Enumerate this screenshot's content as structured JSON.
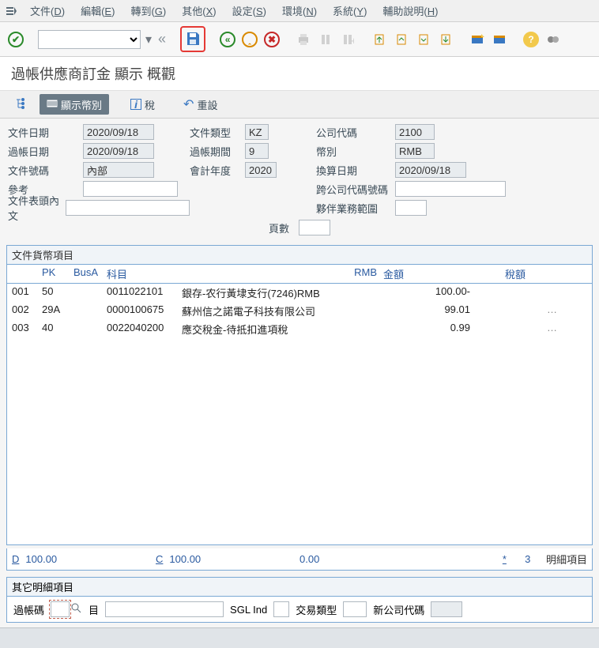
{
  "menu": {
    "items": [
      {
        "label": "文件",
        "key": "D"
      },
      {
        "label": "編輯",
        "key": "E"
      },
      {
        "label": "轉到",
        "key": "G"
      },
      {
        "label": "其他",
        "key": "X"
      },
      {
        "label": "設定",
        "key": "S"
      },
      {
        "label": "環境",
        "key": "N"
      },
      {
        "label": "系統",
        "key": "Y"
      },
      {
        "label": "輔助說明",
        "key": "H"
      }
    ]
  },
  "page_title": "過帳供應商訂金 顯示 概觀",
  "subtoolbar": {
    "show_currency": "顯示幣別",
    "tax": "稅",
    "reset": "重設"
  },
  "form": {
    "doc_date_lbl": "文件日期",
    "doc_date": "2020/09/18",
    "post_date_lbl": "過帳日期",
    "post_date": "2020/09/18",
    "doc_no_lbl": "文件號碼",
    "doc_no": "內部",
    "ref_lbl": "參考",
    "header_text_lbl": "文件表頭內文",
    "doc_type_lbl": "文件類型",
    "doc_type": "KZ",
    "period_lbl": "過帳期間",
    "period": "9",
    "fiscal_year_lbl": "會計年度",
    "fiscal_year": "2020",
    "company_lbl": "公司代碼",
    "company": "2100",
    "currency_lbl": "幣別",
    "currency": "RMB",
    "trans_date_lbl": "換算日期",
    "trans_date": "2020/09/18",
    "cross_cc_lbl": "跨公司代碼號碼",
    "partner_ba_lbl": "夥伴業務範圍",
    "page_lbl": "頁數"
  },
  "grid": {
    "section_title": "文件貨幣項目",
    "head": {
      "pk": "PK",
      "busa": "BusA",
      "acct": "科目",
      "rmb": "RMB",
      "amt": "金額",
      "tax": "稅額"
    },
    "rows": [
      {
        "seq": "001",
        "pk": "50",
        "busa": "",
        "acct": "0011022101",
        "desc": "銀存-农行黃埭支行(7246)RMB",
        "amt": "100.00-",
        "tax": ""
      },
      {
        "seq": "002",
        "pk": "29A",
        "busa": "",
        "acct": "0000100675",
        "desc": "蘇州信之諾電子科技有限公司",
        "amt": "99.01",
        "tax": "",
        "etc": "…"
      },
      {
        "seq": "003",
        "pk": "40",
        "busa": "",
        "acct": "0022040200",
        "desc": "應交稅金-待抵扣進項稅",
        "amt": "0.99",
        "tax": "",
        "etc": "…"
      }
    ]
  },
  "totals": {
    "d_label": "D",
    "d_val": "100.00",
    "c_label": "C",
    "c_val": "100.00",
    "zero": "0.00",
    "star": "*",
    "count": "3",
    "count_lbl": "明細項目"
  },
  "other": {
    "section_title": "其它明細項目",
    "postkey_lbl": "過帳碼",
    "acct_lbl": "目",
    "sgl_lbl": "SGL Ind",
    "trans_type_lbl": "交易類型",
    "new_cc_lbl": "新公司代碼"
  }
}
